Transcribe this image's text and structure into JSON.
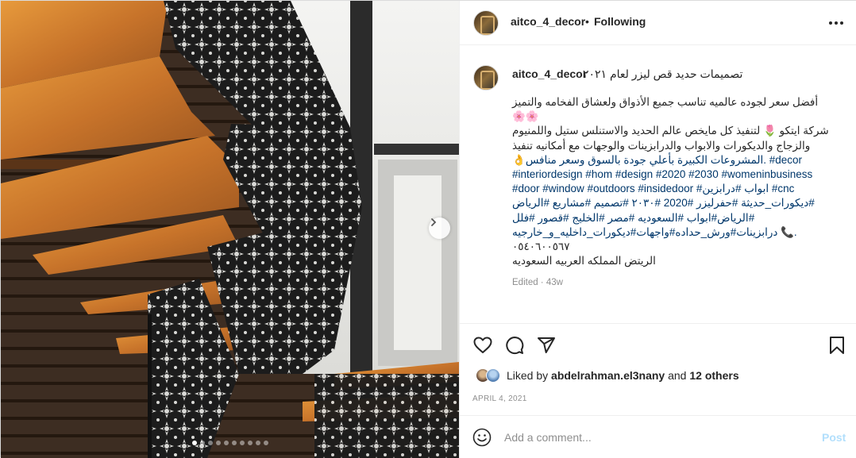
{
  "post": {
    "username": "aitco_4_decor",
    "separator": "•",
    "follow_status": "Following",
    "more_icon": "more-horizontal-icon",
    "media": {
      "slide_count": 10,
      "active_slide": 1,
      "next_icon": "chevron-right-icon"
    }
  },
  "caption": {
    "username": "aitco_4_decor",
    "title": "تصميمات حديد قص ليزر لعام ٢٠٢١",
    "lines": [
      "أفضل سعر لجوده عالميه تناسب جميع الأذواق ولعشاق الفخامه والتميز",
      "🌸🌸",
      "شركة ايتكو 🌷 لتنفيذ كل مايخص عالم الحديد والاستنلس ستيل واللمنيوم",
      "والزجاج والديكورات والابواب والدرابزينات والوجهات مع أمكانيه تنفيذ",
      "👌المشروعات الكبيرة بأعلي جودة بالسوق وسعر منافس. #decor",
      "#interiordesign #hom #design #2020 #2030 #womeninbusiness",
      "#door #window #outdoors #insidedoor #ابواب #درابزين #cnc",
      "ديكورات_حديثة #حفرليزر #2020 #٢٠٣٠ #تصميم #مشاريع #الرياض#",
      "الرياض#ابواب #السعوديه #مصر #الخليج #قصور #فلل#",
      "درابزينات#ورش_حداده#واجهات#ديكورات_داخليه_و_خارجيه 📞.",
      "٠٥٤٠٦٠٠٥٦٧",
      "الريتض المملكه العربيه السعوديه"
    ],
    "edited": "Edited · 43w"
  },
  "actions": {
    "like_icon": "heart-icon",
    "comment_icon": "comment-icon",
    "share_icon": "share-icon",
    "save_icon": "bookmark-icon"
  },
  "likes": {
    "prefix": "Liked by",
    "user": "abdelrahman.el3nany",
    "middle": "and",
    "others": "12 others"
  },
  "date": "APRIL 4, 2021",
  "comment": {
    "placeholder": "Add a comment...",
    "post_label": "Post",
    "emoji_icon": "smiley-icon"
  },
  "colors": {
    "link": "#00376b",
    "post_disabled": "#b2dffc",
    "muted": "#8e8e8e"
  }
}
